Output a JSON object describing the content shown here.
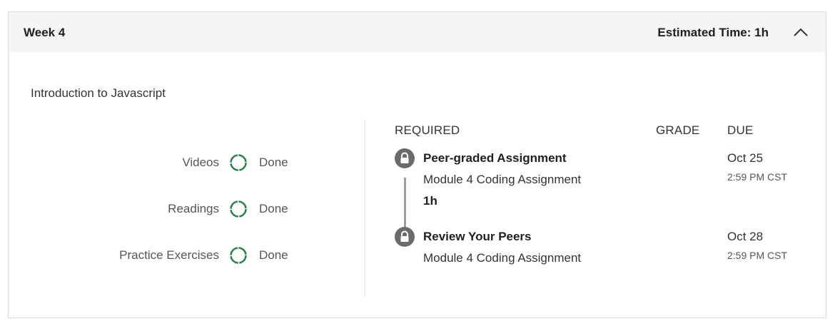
{
  "header": {
    "week": "Week 4",
    "estimated_time": "Estimated Time: 1h",
    "toggle_icon": "chevron-up-icon"
  },
  "module": {
    "title": "Introduction to Javascript"
  },
  "progress": [
    {
      "label": "Videos",
      "status": "Done"
    },
    {
      "label": "Readings",
      "status": "Done"
    },
    {
      "label": "Practice Exercises",
      "status": "Done"
    }
  ],
  "columns": {
    "required": "REQUIRED",
    "grade": "GRADE",
    "due": "DUE"
  },
  "items": [
    {
      "type": "Peer-graded Assignment",
      "name": "Module 4 Coding Assignment",
      "duration": "1h",
      "due_date": "Oct 25",
      "due_time": "2:59 PM CST",
      "icon": "lock-icon"
    },
    {
      "type": "Review Your Peers",
      "name": "Module 4 Coding Assignment",
      "due_date": "Oct 28",
      "due_time": "2:59 PM CST",
      "icon": "lock-icon"
    }
  ],
  "colors": {
    "progress_ring": "#2e7d4f",
    "lock_bg": "#6b6b6b",
    "header_bg": "#f5f5f5"
  }
}
